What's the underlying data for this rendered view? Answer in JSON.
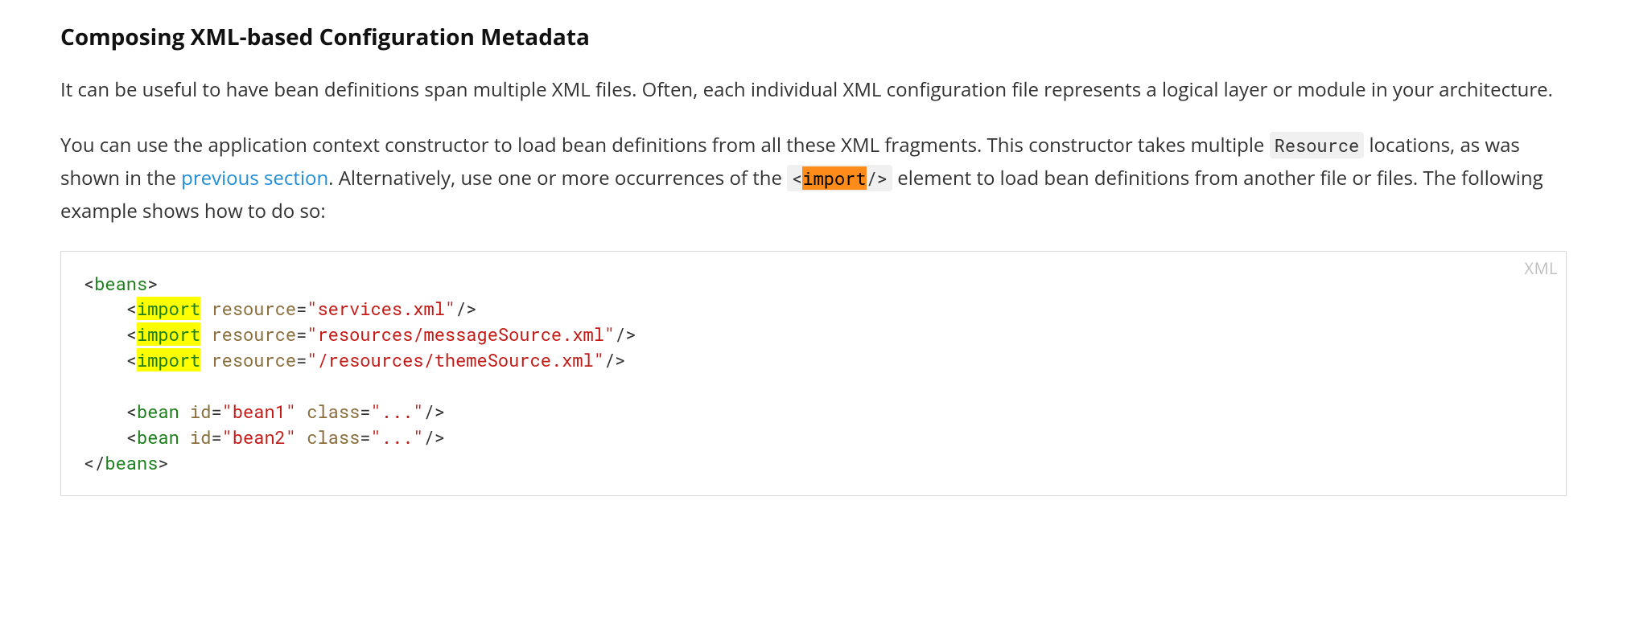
{
  "heading": "Composing XML-based Configuration Metadata",
  "para1": "It can be useful to have bean definitions span multiple XML files. Often, each individual XML configuration file represents a logical layer or module in your architecture.",
  "para2": {
    "pre_code1": "You can use the application context constructor to load bean definitions from all these XML fragments. This constructor takes multiple ",
    "code1": "Resource",
    "mid1": " locations, as was shown in the ",
    "link_text": "previous section",
    "mid2": ". Alternatively, use one or more occurrences of the ",
    "code2_open": "<",
    "code2_hl": "import",
    "code2_close": "/>",
    "tail": " element to load bean definitions from another file or files. The following example shows how to do so:"
  },
  "code": {
    "lang": "XML",
    "beans_open": "beans",
    "beans_close": "beans",
    "import_tag": "import",
    "resource_attr": "resource",
    "bean_tag": "bean",
    "id_attr": "id",
    "class_attr": "class",
    "res1": "\"services.xml\"",
    "res2": "\"resources/messageSource.xml\"",
    "res3": "\"/resources/themeSource.xml\"",
    "bean1_id": "\"bean1\"",
    "bean2_id": "\"bean2\"",
    "class_val": "\"...\""
  }
}
